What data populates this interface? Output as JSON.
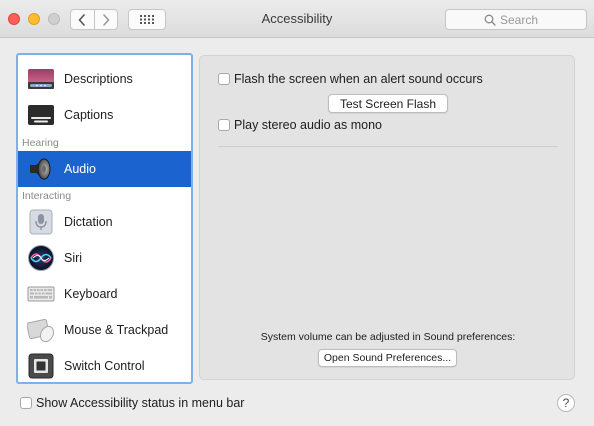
{
  "window": {
    "title": "Accessibility"
  },
  "toolbar": {
    "back_icon": "chevron-left-icon",
    "forward_icon": "chevron-right-icon",
    "grid_icon": "grid-icon"
  },
  "search": {
    "placeholder": "Search",
    "value": "",
    "icon": "search-icon"
  },
  "sidebar": {
    "items": [
      {
        "label": "Descriptions",
        "icon": "descriptions-icon",
        "selected": false
      },
      {
        "label": "Captions",
        "icon": "captions-icon",
        "selected": false
      },
      {
        "label": "Audio",
        "icon": "speaker-icon",
        "selected": true
      },
      {
        "label": "Dictation",
        "icon": "microphone-icon",
        "selected": false
      },
      {
        "label": "Siri",
        "icon": "siri-icon",
        "selected": false
      },
      {
        "label": "Keyboard",
        "icon": "keyboard-icon",
        "selected": false
      },
      {
        "label": "Mouse & Trackpad",
        "icon": "mouse-trackpad-icon",
        "selected": false
      },
      {
        "label": "Switch Control",
        "icon": "switch-control-icon",
        "selected": false
      }
    ],
    "headers": {
      "hearing": "Hearing",
      "interacting": "Interacting"
    }
  },
  "audio": {
    "flash_label": "Flash the screen when an alert sound occurs",
    "flash_checked": false,
    "test_flash_button": "Test Screen Flash",
    "mono_label": "Play stereo audio as mono",
    "mono_checked": false,
    "volume_note": "System volume can be adjusted in Sound preferences:",
    "open_sound_button": "Open Sound Preferences..."
  },
  "footer": {
    "status_label": "Show Accessibility status in menu bar",
    "status_checked": false,
    "help_label": "?"
  },
  "colors": {
    "selection": "#1b64d0",
    "sidebar_focus_ring": "#7fb0e6",
    "close": "#fd5f57",
    "minimize": "#febc2e",
    "zoom_inactive": "#cfcfcf"
  }
}
